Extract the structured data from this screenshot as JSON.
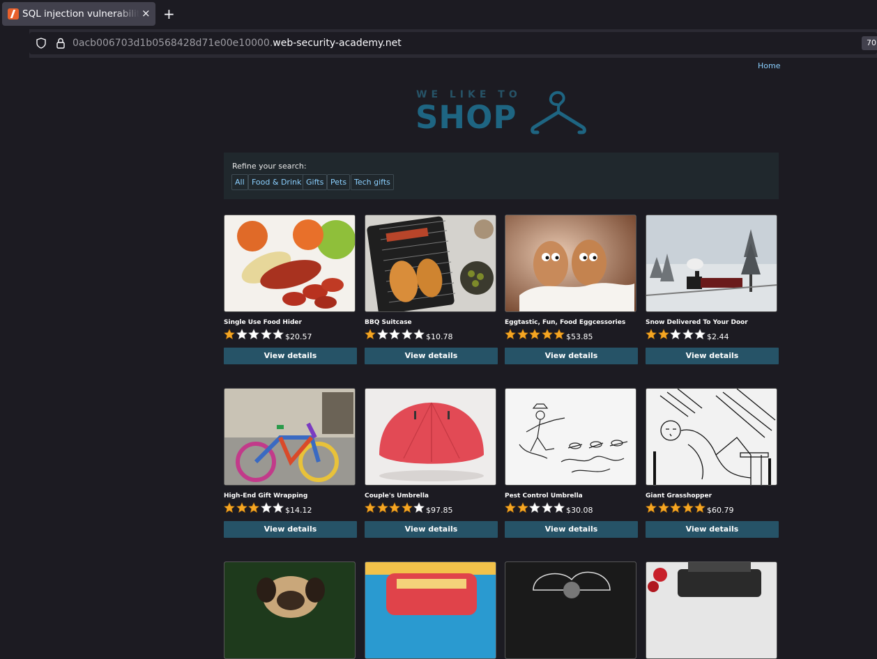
{
  "browser": {
    "tab_title": "SQL injection vulnerability",
    "tab_close": "×",
    "new_tab": "+",
    "url_prefix": "0acb006703d1b0568428d71e00e10000.",
    "url_domain": "web-security-academy.net",
    "zoom": "70"
  },
  "header": {
    "home_link": "Home",
    "logo_small": "WE LIKE TO",
    "logo_big": "SHOP"
  },
  "filters": {
    "label": "Refine your search:",
    "items": [
      "All",
      "Food & Drink",
      "Gifts",
      "Pets",
      "Tech gifts"
    ]
  },
  "colors": {
    "accent": "#265367",
    "link": "#8bd0ff",
    "star_filled": "#f5a623",
    "star_empty": "#ffffff"
  },
  "products": [
    {
      "name": "Single Use Food Hider",
      "rating": 1,
      "price": "$20.57",
      "button": "View details"
    },
    {
      "name": "BBQ Suitcase",
      "rating": 1,
      "price": "$10.78",
      "button": "View details"
    },
    {
      "name": "Eggtastic, Fun, Food Eggcessories",
      "rating": 5,
      "price": "$53.85",
      "button": "View details"
    },
    {
      "name": "Snow Delivered To Your Door",
      "rating": 2,
      "price": "$2.44",
      "button": "View details"
    },
    {
      "name": "High-End Gift Wrapping",
      "rating": 3,
      "price": "$14.12",
      "button": "View details"
    },
    {
      "name": "Couple's Umbrella",
      "rating": 4,
      "price": "$97.85",
      "button": "View details"
    },
    {
      "name": "Pest Control Umbrella",
      "rating": 2,
      "price": "$30.08",
      "button": "View details"
    },
    {
      "name": "Giant Grasshopper",
      "rating": 5,
      "price": "$60.79",
      "button": "View details"
    }
  ]
}
